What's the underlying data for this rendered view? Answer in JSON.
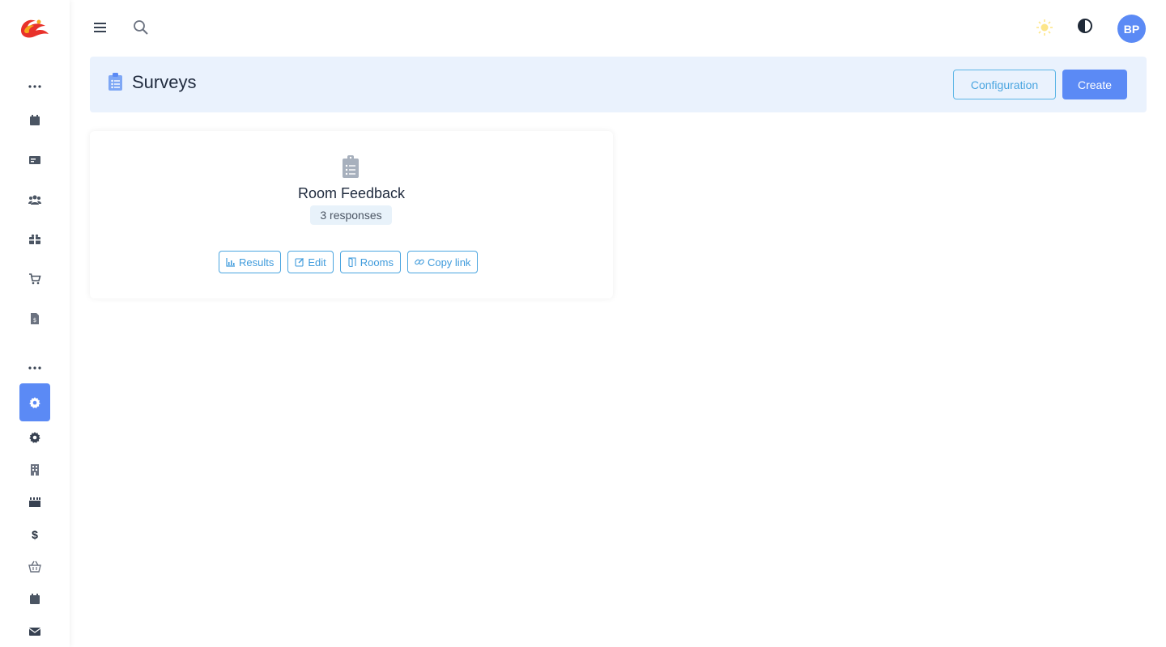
{
  "topbar": {
    "menu_icon": "hamburger-icon",
    "search_icon": "search-icon",
    "theme_icon": "sun-icon",
    "contrast_icon": "contrast-icon",
    "avatar_initials": "BP"
  },
  "sidebar": {
    "items": [
      {
        "icon": "calendar-icon"
      },
      {
        "icon": "card-icon"
      },
      {
        "icon": "users-icon"
      },
      {
        "icon": "gift-icon"
      },
      {
        "icon": "cart-icon"
      },
      {
        "icon": "invoice-icon"
      },
      {
        "icon": "settings-icon",
        "active": true
      },
      {
        "icon": "gear-icon"
      },
      {
        "icon": "building-icon"
      },
      {
        "icon": "calendar-grid-icon"
      },
      {
        "icon": "dollar-icon",
        "label": "$"
      },
      {
        "icon": "basket-icon"
      },
      {
        "icon": "calendar-icon"
      },
      {
        "icon": "mail-icon"
      }
    ]
  },
  "header": {
    "title": "Surveys",
    "configuration_label": "Configuration",
    "create_label": "Create"
  },
  "survey_card": {
    "title": "Room Feedback",
    "responses": "3 responses",
    "actions": {
      "results": "Results",
      "edit": "Edit",
      "rooms": "Rooms",
      "copy_link": "Copy link"
    }
  },
  "colors": {
    "primary": "#5b8af5",
    "accent_outline": "#4aa5e0",
    "header_bg": "#eaf2fd"
  }
}
